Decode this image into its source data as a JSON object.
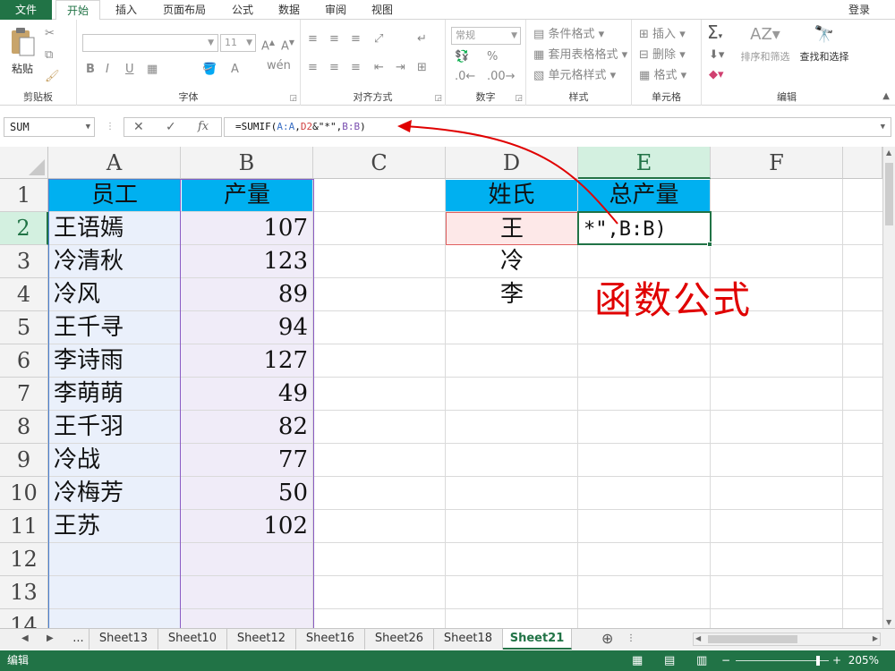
{
  "tabs": [
    "文件",
    "开始",
    "插入",
    "页面布局",
    "公式",
    "数据",
    "审阅",
    "视图"
  ],
  "login": "登录",
  "ribbon": {
    "clipboard": {
      "paste": "粘贴",
      "label": "剪贴板"
    },
    "font": {
      "size": "11",
      "label": "字体",
      "bold": "B",
      "italic": "I",
      "underline": "U",
      "phonetic": "wén"
    },
    "alignment": {
      "label": "对齐方式"
    },
    "number": {
      "format": "常规",
      "label": "数字",
      "percent": "%"
    },
    "styles": {
      "conditional": "条件格式",
      "table": "套用表格格式",
      "cell": "单元格样式",
      "label": "样式"
    },
    "cells": {
      "insert": "插入",
      "delete": "删除",
      "format": "格式",
      "label": "单元格"
    },
    "editing": {
      "sort": "排序和筛选",
      "find": "查找和选择",
      "label": "编辑",
      "sigma": "Σ"
    }
  },
  "formula_bar": {
    "name_box": "SUM",
    "fx": "fx",
    "parts": [
      "=SUMIF(",
      "A:A",
      ",",
      "D2",
      "&\"*\",",
      "B:B",
      ")"
    ]
  },
  "columns": [
    "A",
    "B",
    "C",
    "D",
    "E",
    "F"
  ],
  "rows": [
    "1",
    "2",
    "3",
    "4",
    "5",
    "6",
    "7",
    "8",
    "9",
    "10",
    "11",
    "12",
    "13",
    "14"
  ],
  "headers": {
    "a": "员工",
    "b": "产量",
    "d": "姓氏",
    "e": "总产量"
  },
  "employees": [
    {
      "name": "王语嫣",
      "qty": "107"
    },
    {
      "name": "冷清秋",
      "qty": "123"
    },
    {
      "name": "冷风",
      "qty": "89"
    },
    {
      "name": "王千寻",
      "qty": "94"
    },
    {
      "name": "李诗雨",
      "qty": "127"
    },
    {
      "name": "李萌萌",
      "qty": "49"
    },
    {
      "name": "王千羽",
      "qty": "82"
    },
    {
      "name": "冷战",
      "qty": "77"
    },
    {
      "name": "冷梅芳",
      "qty": "50"
    },
    {
      "name": "王苏",
      "qty": "102"
    }
  ],
  "surnames": [
    "王",
    "冷",
    "李"
  ],
  "edit_cell": "*\",B:B)",
  "annotation": "函数公式",
  "sheets": [
    "...",
    "Sheet13",
    "Sheet10",
    "Sheet12",
    "Sheet16",
    "Sheet26",
    "Sheet18",
    "Sheet21"
  ],
  "status": {
    "mode": "编辑",
    "zoom": "205%"
  },
  "colors": {
    "accent": "#217346",
    "header_fill": "#00b0f0",
    "arrow": "#e00000"
  }
}
